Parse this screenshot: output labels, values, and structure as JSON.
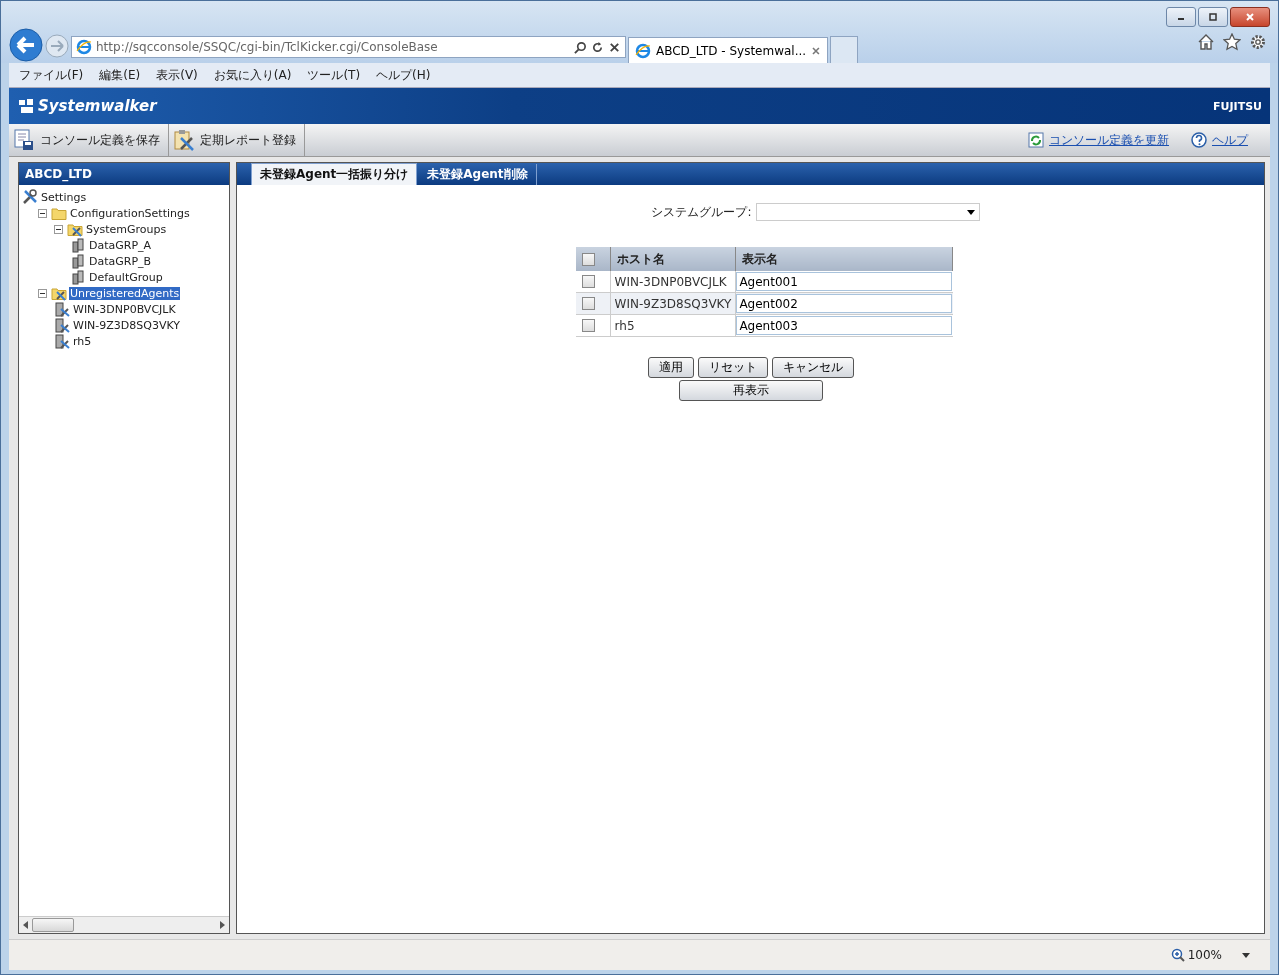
{
  "browser": {
    "address": "http://sqcconsole/SSQC/cgi-bin/TclKicker.cgi/ConsoleBase",
    "tab_title": "ABCD_LTD - Systemwal...",
    "zoom": "100%"
  },
  "menu": [
    "ファイル(F)",
    "編集(E)",
    "表示(V)",
    "お気に入り(A)",
    "ツール(T)",
    "ヘルプ(H)"
  ],
  "header": {
    "logo": "Systemwalker",
    "brand": "FUJITSU"
  },
  "toolbar": {
    "left": [
      {
        "label": "コンソール定義を保存",
        "kind": "save"
      },
      {
        "label": "定期レポート登録",
        "kind": "report"
      }
    ],
    "right": [
      {
        "label": "コンソール定義を更新",
        "kind": "refresh"
      },
      {
        "label": "ヘルプ",
        "kind": "help"
      }
    ]
  },
  "sidebar": {
    "title": "ABCD_LTD",
    "tree": [
      {
        "label": "Settings",
        "kind": "tools",
        "selected": false,
        "children": [
          {
            "label": "ConfigurationSettings",
            "kind": "folder",
            "expanded": true,
            "selected": false,
            "children": [
              {
                "label": "SystemGroups",
                "kind": "groupfolder",
                "expanded": true,
                "selected": false,
                "children": [
                  {
                    "label": "DataGRP_A",
                    "kind": "group",
                    "selected": false
                  },
                  {
                    "label": "DataGRP_B",
                    "kind": "group",
                    "selected": false
                  },
                  {
                    "label": "DefaultGroup",
                    "kind": "group",
                    "selected": false
                  }
                ]
              }
            ]
          },
          {
            "label": "UnregisteredAgents",
            "kind": "groupfolder",
            "expanded": true,
            "selected": true,
            "children": [
              {
                "label": "WIN-3DNP0BVCJLK",
                "kind": "agent",
                "selected": false
              },
              {
                "label": "WIN-9Z3D8SQ3VKY",
                "kind": "agent",
                "selected": false
              },
              {
                "label": "rh5",
                "kind": "agent",
                "selected": false
              }
            ]
          }
        ]
      }
    ]
  },
  "tabs": [
    {
      "label": "未登録Agent一括振り分け",
      "selected": true
    },
    {
      "label": "未登録Agent削除",
      "selected": false
    }
  ],
  "form": {
    "label": "システムグループ:"
  },
  "table": {
    "columns": [
      "ホスト名",
      "表示名"
    ],
    "all_checked": false,
    "rows": [
      {
        "checked": false,
        "host": "WIN-3DNP0BVCJLK",
        "display": "Agent001"
      },
      {
        "checked": false,
        "host": "WIN-9Z3D8SQ3VKY",
        "display": "Agent002"
      },
      {
        "checked": false,
        "host": "rh5",
        "display": "Agent003"
      }
    ]
  },
  "buttons": [
    "適用",
    "リセット",
    "キャンセル"
  ],
  "wide_button": "再表示"
}
